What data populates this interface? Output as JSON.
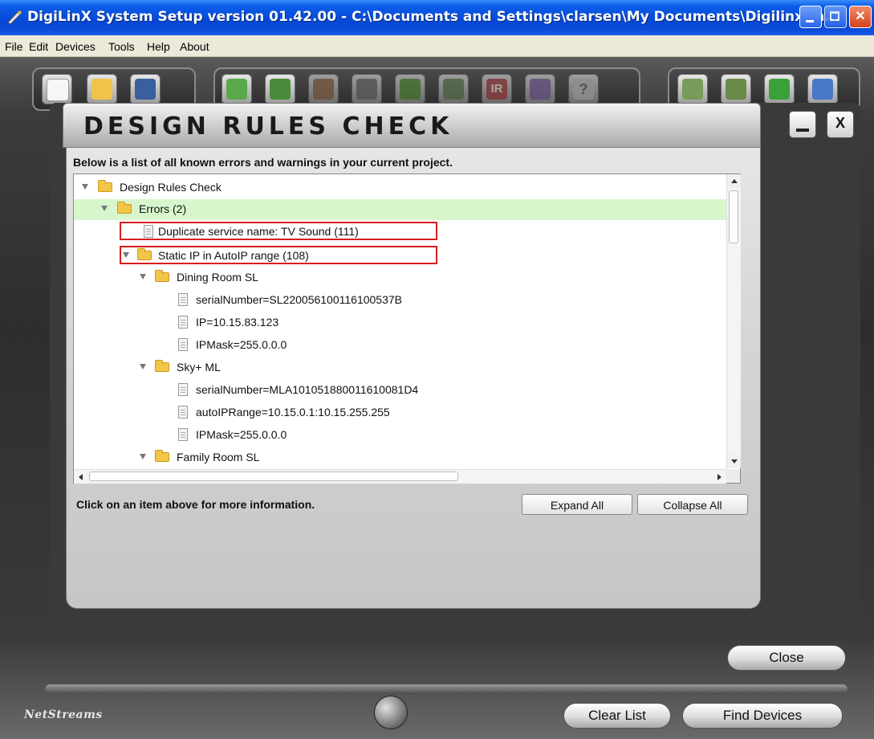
{
  "window": {
    "title": "DigiLinX System Setup version 01.42.00 - C:\\Documents and Settings\\clarsen\\My Documents\\Digilinx\\ra..."
  },
  "menu": {
    "items": [
      "File",
      "Edit",
      "Devices",
      "Tools",
      "Help",
      "About"
    ]
  },
  "toolbar": {
    "groups": [
      {
        "name": "file",
        "tools": [
          "new-project-icon",
          "open-folder-icon",
          "save-icon"
        ]
      },
      {
        "name": "devices",
        "tools": [
          "add-device-icon",
          "remove-device-icon",
          "device-tool-icon",
          "disabled-tool-icon",
          "arrow-tool-icon",
          "wrench-tool-icon",
          "ir-icon",
          "refresh-icon",
          "help-icon"
        ],
        "ir_label": "IR",
        "help_label": "?"
      },
      {
        "name": "deploy",
        "tools": [
          "upload-icon",
          "transfer-icon",
          "download-icon",
          "wizard-icon"
        ]
      }
    ]
  },
  "dialog": {
    "title": "DESIGN RULES CHECK",
    "intro": "Below is a list of all known errors and warnings in your current project.",
    "hint": "Click on an item above for more information.",
    "expand_all": "Expand All",
    "collapse_all": "Collapse All",
    "minimize_label": "",
    "close_label": "X"
  },
  "tree": {
    "rows": [
      {
        "label": "Design Rules Check",
        "type": "folder",
        "expanded": true
      },
      {
        "label": "Errors (2)",
        "type": "folder",
        "expanded": true,
        "selected": true
      },
      {
        "label": "Duplicate service name: TV Sound (111)",
        "type": "leaf",
        "highlighted": true
      },
      {
        "label": "Static IP in AutoIP range (108)",
        "type": "folder",
        "expanded": true,
        "highlighted": true
      },
      {
        "label": "Dining Room SL",
        "type": "folder",
        "expanded": true
      },
      {
        "label": "serialNumber=SL220056100116100537B",
        "type": "leaf"
      },
      {
        "label": "IP=10.15.83.123",
        "type": "leaf"
      },
      {
        "label": "IPMask=255.0.0.0",
        "type": "leaf"
      },
      {
        "label": "Sky+ ML",
        "type": "folder",
        "expanded": true
      },
      {
        "label": "serialNumber=MLA101051880011610081D4",
        "type": "leaf"
      },
      {
        "label": "autoIPRange=10.15.0.1:10.15.255.255",
        "type": "leaf"
      },
      {
        "label": "IPMask=255.0.0.0",
        "type": "leaf"
      },
      {
        "label": "Family Room SL",
        "type": "folder",
        "expanded": true
      }
    ]
  },
  "buttons": {
    "close": "Close",
    "clear_list": "Clear List",
    "find_devices": "Find Devices"
  },
  "brand": {
    "name_main": "NetStreams"
  },
  "colors": {
    "titlebar": "#0a4bd8",
    "selected_row": "#d8f6cc",
    "highlight_box": "#d81e1e"
  }
}
